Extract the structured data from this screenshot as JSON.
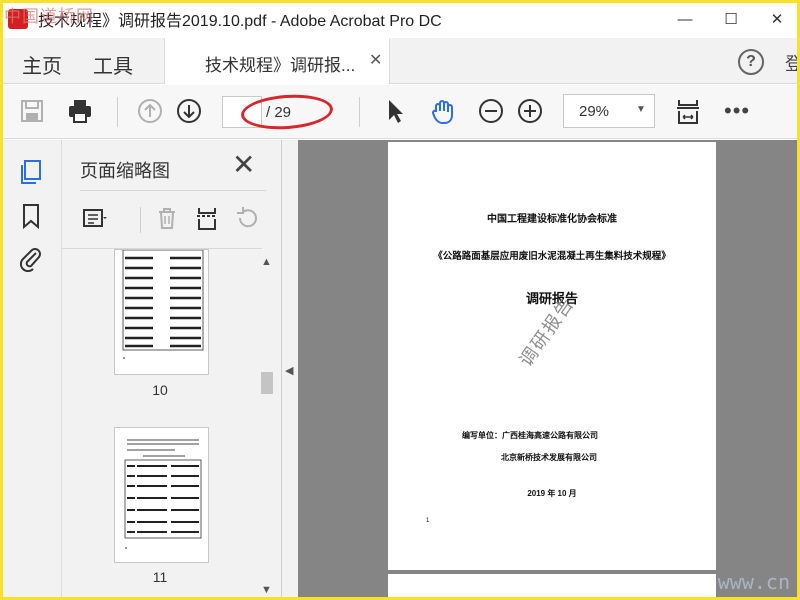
{
  "watermark": {
    "corner_text": "中国道桥网",
    "bottom_text": "www.cn"
  },
  "window": {
    "title": "技术规程》调研报告2019.10.pdf - Adobe Acrobat Pro DC",
    "minimize": "—",
    "maximize": "☐",
    "close": "✕"
  },
  "tabs": {
    "home": "主页",
    "tools": "工具",
    "document": "技术规程》调研报...",
    "document_close": "✕",
    "help": "?",
    "signin_partial": "登"
  },
  "toolbar": {
    "current_page": "",
    "page_total": "/ 29",
    "zoom": "29%",
    "more": "•••",
    "page_highlighted": true,
    "highlight_color": "#d8262c"
  },
  "panel": {
    "title": "页面缩略图",
    "close": "✕",
    "thumbnails": [
      {
        "page_label": "10"
      },
      {
        "page_label": "11"
      }
    ]
  },
  "page": {
    "org": "中国工程建设标准化协会标准",
    "title": "《公路路面基层应用废旧水泥混凝土再生集料技术规程》",
    "report": "调研报告",
    "stamp": "调研报告",
    "unit_label": "编写单位：广西桂海高速公路有限公司",
    "unit_2": "北京新桥技术发展有限公司",
    "date": "2019 年 10 月",
    "page_number": "1"
  },
  "colors": {
    "frame": "#f7e12a",
    "accent_blue": "#2a6fdb",
    "doc_background": "#858585"
  }
}
